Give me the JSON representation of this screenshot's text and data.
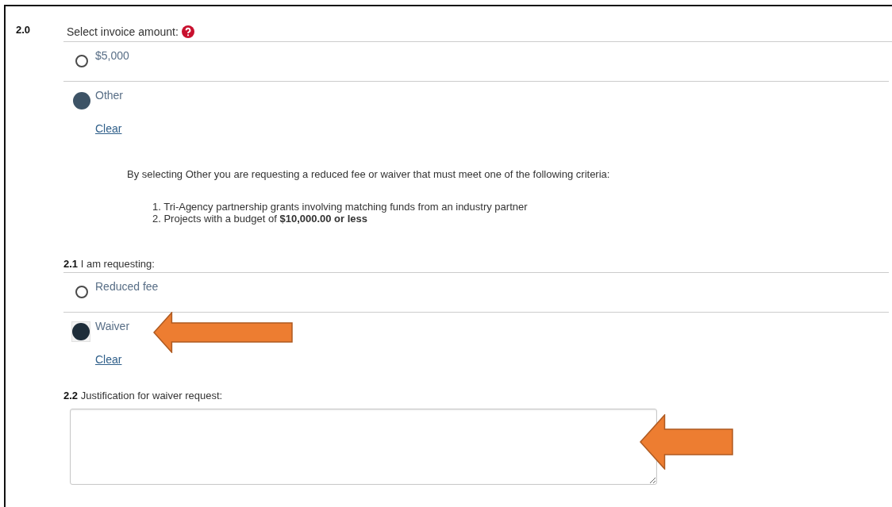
{
  "section": {
    "number": "2.0",
    "question": "Select invoice amount:",
    "options": [
      {
        "label": "$5,000",
        "selected": false,
        "focused": false
      },
      {
        "label": "Other",
        "selected": true,
        "focused": false
      }
    ],
    "clear": "Clear",
    "note": "By selecting Other you are requesting a reduced fee or waiver that must meet one of the following criteria:",
    "criteria": [
      "1. Tri-Agency partnership grants involving matching funds from an industry partner",
      "2. Projects with a budget of **$10,000.00 or less**"
    ]
  },
  "subsection_1": {
    "number": "2.1",
    "question": "I am requesting:",
    "options": [
      {
        "label": "Reduced fee",
        "selected": false,
        "focused": false
      },
      {
        "label": "Waiver",
        "selected": true,
        "focused": true
      }
    ],
    "clear": "Clear"
  },
  "subsection_2": {
    "number": "2.2",
    "question": "Justification for waiver request:"
  }
}
